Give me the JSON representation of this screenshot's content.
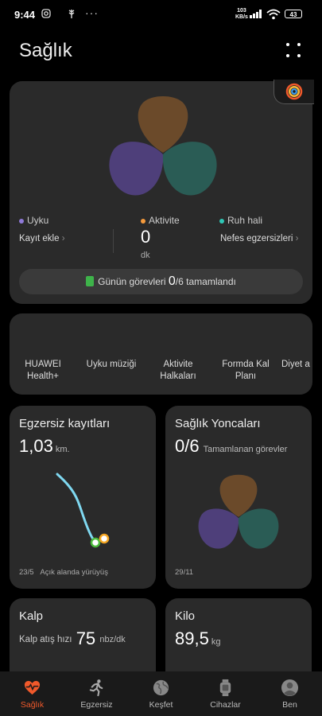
{
  "status": {
    "time": "9:44",
    "net_speed_value": "103",
    "net_speed_unit": "KB/s",
    "battery": "43"
  },
  "header": {
    "title": "Sağlık"
  },
  "summary": {
    "sleep": {
      "label": "Uyku",
      "action": "Kayıt ekle",
      "color": "#8f7ad9"
    },
    "activity": {
      "label": "Aktivite",
      "value": "0",
      "unit": "dk",
      "color": "#f59a3c"
    },
    "mood": {
      "label": "Ruh hali",
      "action": "Nefes egzersizleri",
      "color": "#2fc7b6"
    },
    "tasks": {
      "prefix": "Günün görevleri",
      "done": "0",
      "suffix": "/6 tamamlandı"
    }
  },
  "services": [
    {
      "label": "HUAWEI Health+"
    },
    {
      "label": "Uyku müziği"
    },
    {
      "label": "Aktivite Halkaları"
    },
    {
      "label": "Formda Kal Planı"
    },
    {
      "label": "Diyet a"
    }
  ],
  "exercise": {
    "title": "Egzersiz kayıtları",
    "value": "1,03",
    "unit": "km.",
    "date": "23/5",
    "desc": "Açık alanda yürüyüş"
  },
  "clover": {
    "title": "Sağlık Yoncaları",
    "value": "0/6",
    "desc": "Tamamlanan görevler",
    "date": "29/11"
  },
  "heart": {
    "title": "Kalp",
    "label": "Kalp atış hızı",
    "value": "75",
    "unit": "nbz/dk"
  },
  "weight": {
    "title": "Kilo",
    "value": "89,5",
    "unit": "kg"
  },
  "nav": [
    {
      "label": "Sağlık",
      "icon": "heart-icon",
      "active": true
    },
    {
      "label": "Egzersiz",
      "icon": "runner-icon"
    },
    {
      "label": "Keşfet",
      "icon": "globe-icon"
    },
    {
      "label": "Cihazlar",
      "icon": "watch-icon"
    },
    {
      "label": "Ben",
      "icon": "profile-icon"
    }
  ],
  "colors": {
    "accent": "#f0592b",
    "card": "#2a2a2a",
    "petal_orange": "#6b4a2a",
    "petal_purple": "#4e3f7a",
    "petal_teal": "#2a5c55"
  }
}
